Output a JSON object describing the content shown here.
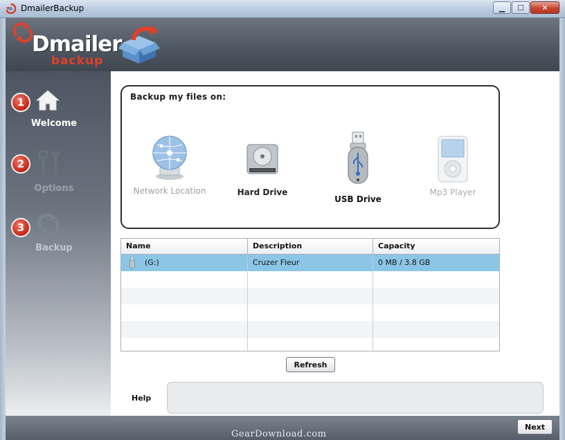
{
  "window": {
    "title": "DmailerBackup",
    "minimize_symbol": "▁",
    "maximize_symbol": "☐",
    "close_symbol": "✕"
  },
  "header": {
    "logo_main": "Dmailer",
    "logo_sub": "backup"
  },
  "sidebar": {
    "steps": [
      {
        "number": "1",
        "label": "Welcome",
        "icon": "home-icon",
        "state": "active"
      },
      {
        "number": "2",
        "label": "Options",
        "icon": "tools-icon",
        "state": "inactive"
      },
      {
        "number": "3",
        "label": "Backup",
        "icon": "sync-icon",
        "state": "disabled"
      }
    ]
  },
  "panel": {
    "title": "Backup my files on:",
    "devices": [
      {
        "label": "Network Location",
        "icon": "network-globe-icon",
        "state": "dim"
      },
      {
        "label": "Hard Drive",
        "icon": "hard-drive-icon",
        "state": "normal"
      },
      {
        "label": "USB Drive",
        "icon": "usb-drive-icon",
        "state": "selected"
      },
      {
        "label": "Mp3 Player",
        "icon": "mp3-player-icon",
        "state": "dim"
      }
    ]
  },
  "table": {
    "columns": [
      "Name",
      "Description",
      "Capacity"
    ],
    "rows": [
      {
        "name": "(G:)",
        "description": "Cruzer Fleur",
        "capacity": "0 MB / 3.8 GB"
      }
    ]
  },
  "buttons": {
    "refresh": "Refresh",
    "next": "Next"
  },
  "help": {
    "label": "Help",
    "text": ""
  },
  "watermark": "GearDownload.com",
  "colors": {
    "accent_red": "#c62a1a",
    "selected_row": "#8cc6e6",
    "sidebar_dark": "#4c5561"
  }
}
